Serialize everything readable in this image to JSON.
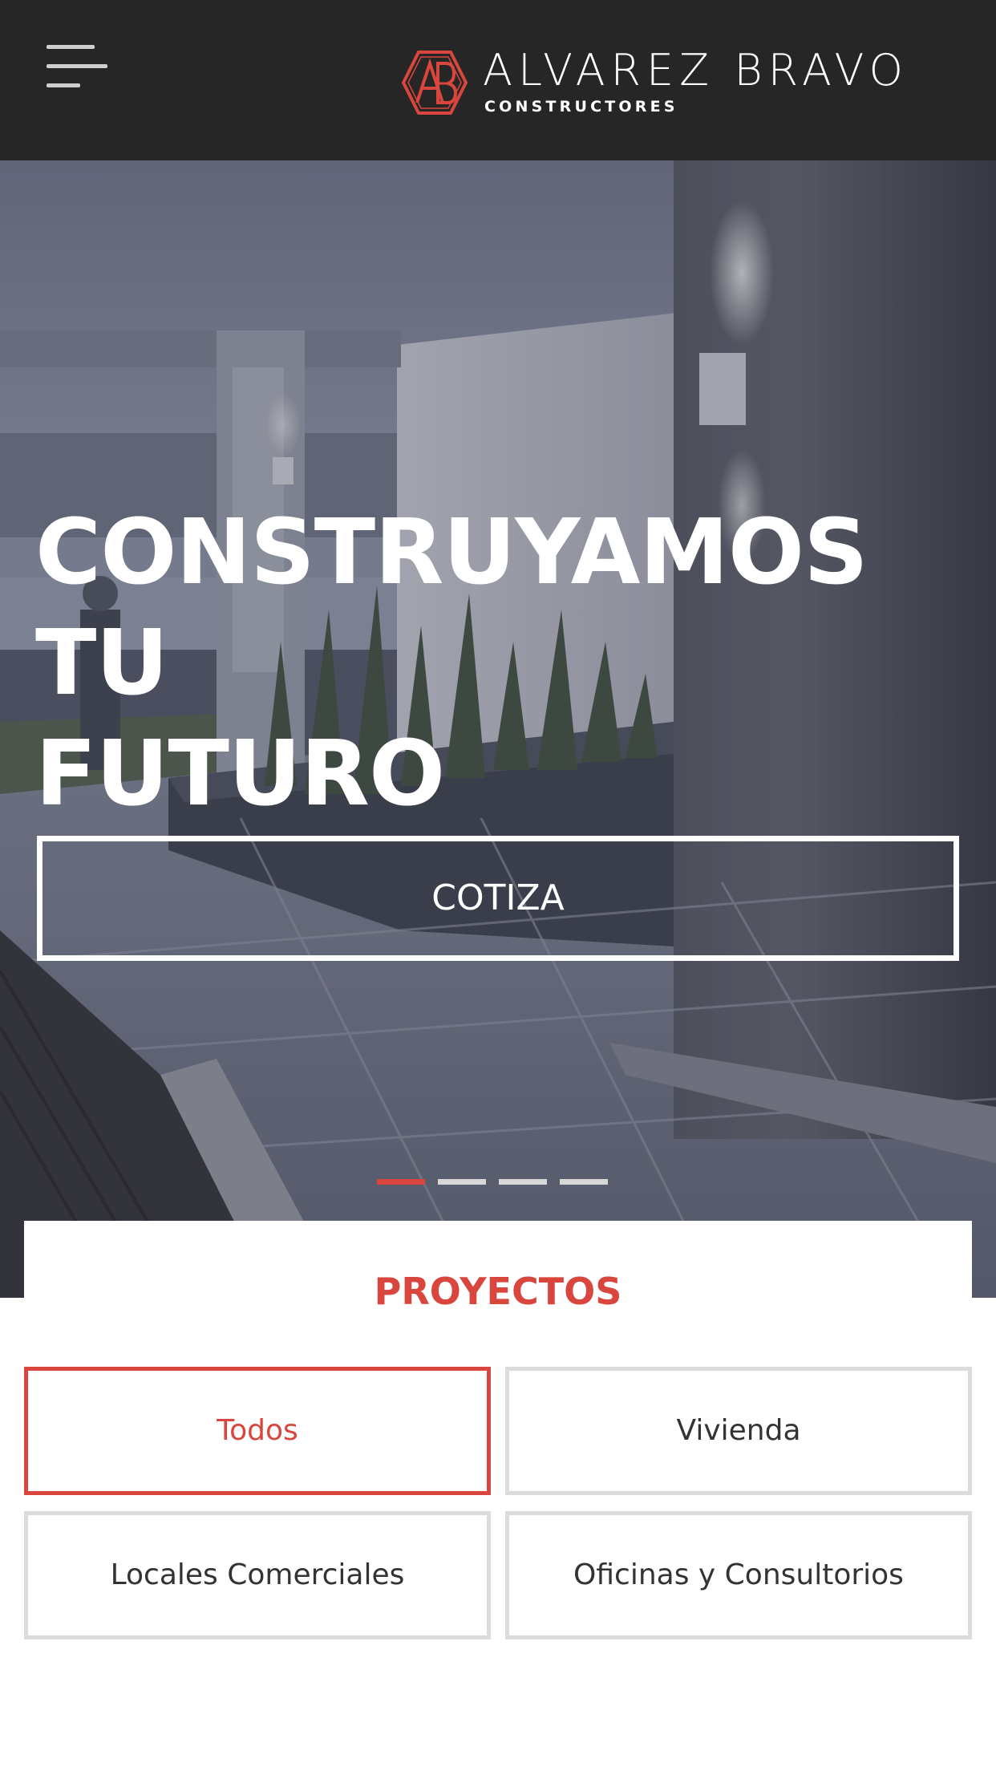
{
  "header": {
    "brand_name": "ALVAREZ BRAVO",
    "brand_sub": "CONSTRUCTORES",
    "logo_monogram": "AB",
    "menu_icon": "hamburger-menu-icon"
  },
  "hero": {
    "title_line1": "CONSTRUYAMOS TU",
    "title_line2": "FUTURO",
    "cta_label": "COTIZA",
    "slides": {
      "total": 4,
      "active_index": 0
    }
  },
  "projects": {
    "title": "PROYECTOS",
    "filters": [
      {
        "label": "Todos",
        "active": true
      },
      {
        "label": "Vivienda",
        "active": false
      },
      {
        "label": "Locales Comerciales",
        "active": false
      },
      {
        "label": "Oficinas y Consultorios",
        "active": false
      }
    ]
  },
  "colors": {
    "accent": "#d9463e",
    "header_bg": "#262626",
    "inactive_border": "#dcdcdc",
    "text_dark": "#333333"
  }
}
